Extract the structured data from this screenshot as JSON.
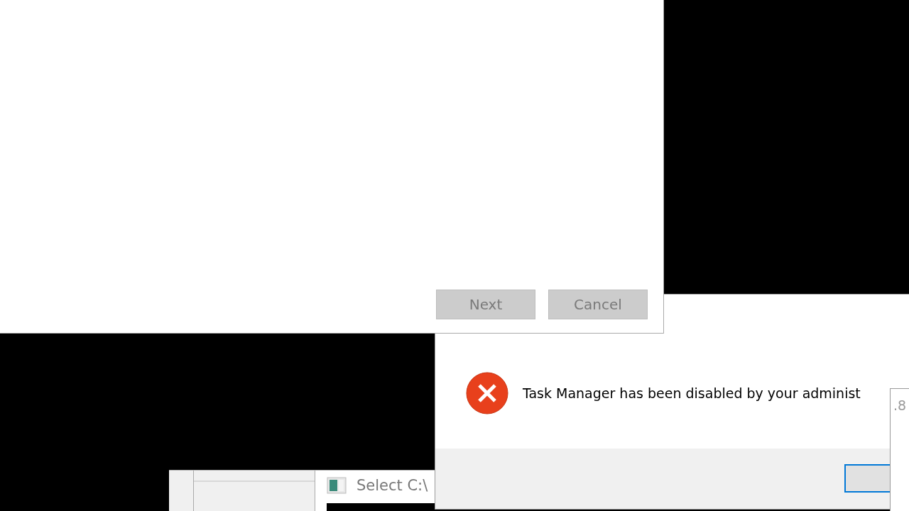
{
  "wizard": {
    "buttons": [
      {
        "label": "Next",
        "disabled": true
      },
      {
        "label": "Cancel",
        "disabled": true
      }
    ]
  },
  "select_window": {
    "title": "Select C:\\"
  },
  "error_dialog": {
    "message": "Task Manager has been disabled by your administ",
    "ok_button": {
      "focused": true
    }
  },
  "side_window": {
    "text": ".8"
  }
}
